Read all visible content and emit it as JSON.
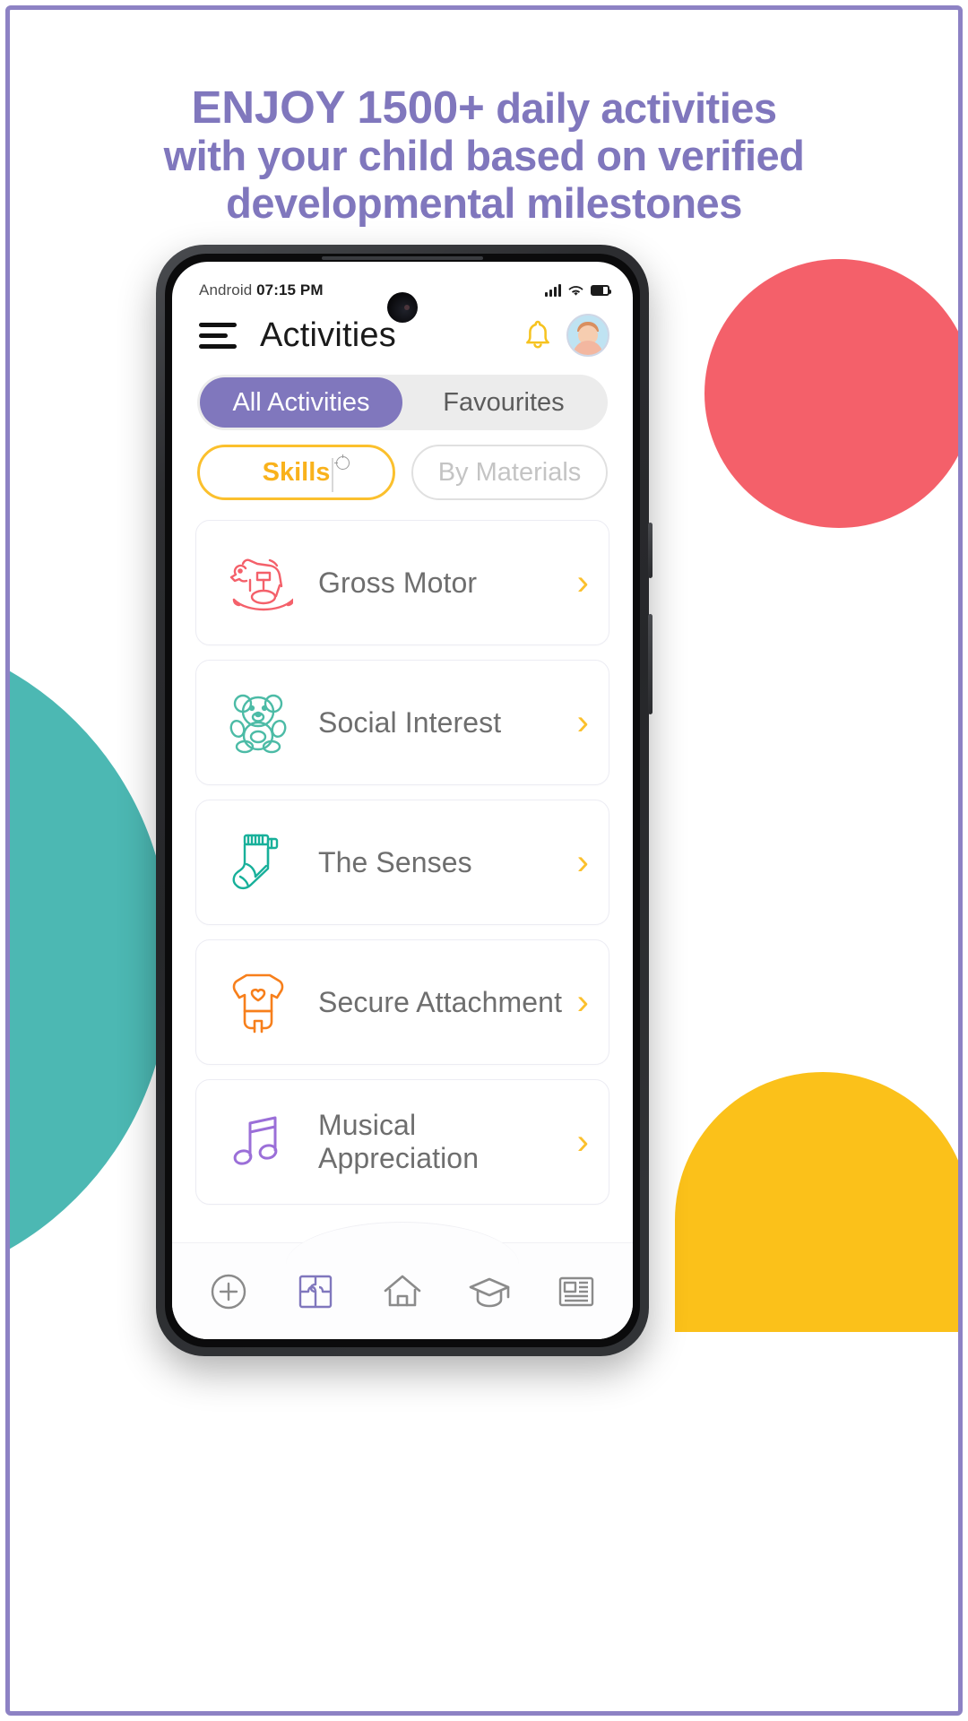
{
  "theme": {
    "purple": "#8077bd",
    "yellow": "#fbc02d",
    "teal": "#4cb8b3",
    "red": "#f4606a",
    "orange": "#f77f1b"
  },
  "headline": {
    "strong": "ENJOY 1500+",
    "rest": " daily activities",
    "line2": "with your child based on verified",
    "line3": "developmental milestones"
  },
  "phone": {
    "statusbar": {
      "os_label": "Android",
      "time": "07:15 PM",
      "signal_icon": "cellular-signal-icon",
      "wifi_icon": "wifi-icon",
      "battery_icon": "battery-icon"
    },
    "appbar": {
      "menu_icon": "hamburger-menu-icon",
      "title": "Activities",
      "bell_icon": "notification-bell-icon",
      "avatar_icon": "user-avatar"
    },
    "segment": {
      "tabs": [
        {
          "label": "All Activities",
          "active": true
        },
        {
          "label": "Favourites",
          "active": false
        }
      ]
    },
    "pills": [
      {
        "label": "Skills",
        "selected": true
      },
      {
        "label": "By Materials",
        "selected": false
      }
    ],
    "cards": [
      {
        "label": "Gross Motor",
        "icon": "rocking-horse-icon",
        "color": "#f4606a",
        "chevron": "›"
      },
      {
        "label": "Social Interest",
        "icon": "teddy-bear-icon",
        "color": "#4cbba6",
        "chevron": "›"
      },
      {
        "label": "The Senses",
        "icon": "baby-sock-icon",
        "color": "#18b09a",
        "chevron": "›"
      },
      {
        "label": "Secure Attachment",
        "icon": "onesie-heart-icon",
        "color": "#f77f1b",
        "chevron": "›"
      },
      {
        "label": "Musical Appreciation",
        "icon": "music-note-icon",
        "color": "#9b6fd8",
        "chevron": "›"
      }
    ],
    "bottomnav": [
      {
        "icon": "plus-circle-icon",
        "active": false
      },
      {
        "icon": "puzzle-piece-icon",
        "active": true
      },
      {
        "icon": "home-icon",
        "active": false
      },
      {
        "icon": "graduation-cap-icon",
        "active": false
      },
      {
        "icon": "news-article-icon",
        "active": false
      }
    ]
  }
}
